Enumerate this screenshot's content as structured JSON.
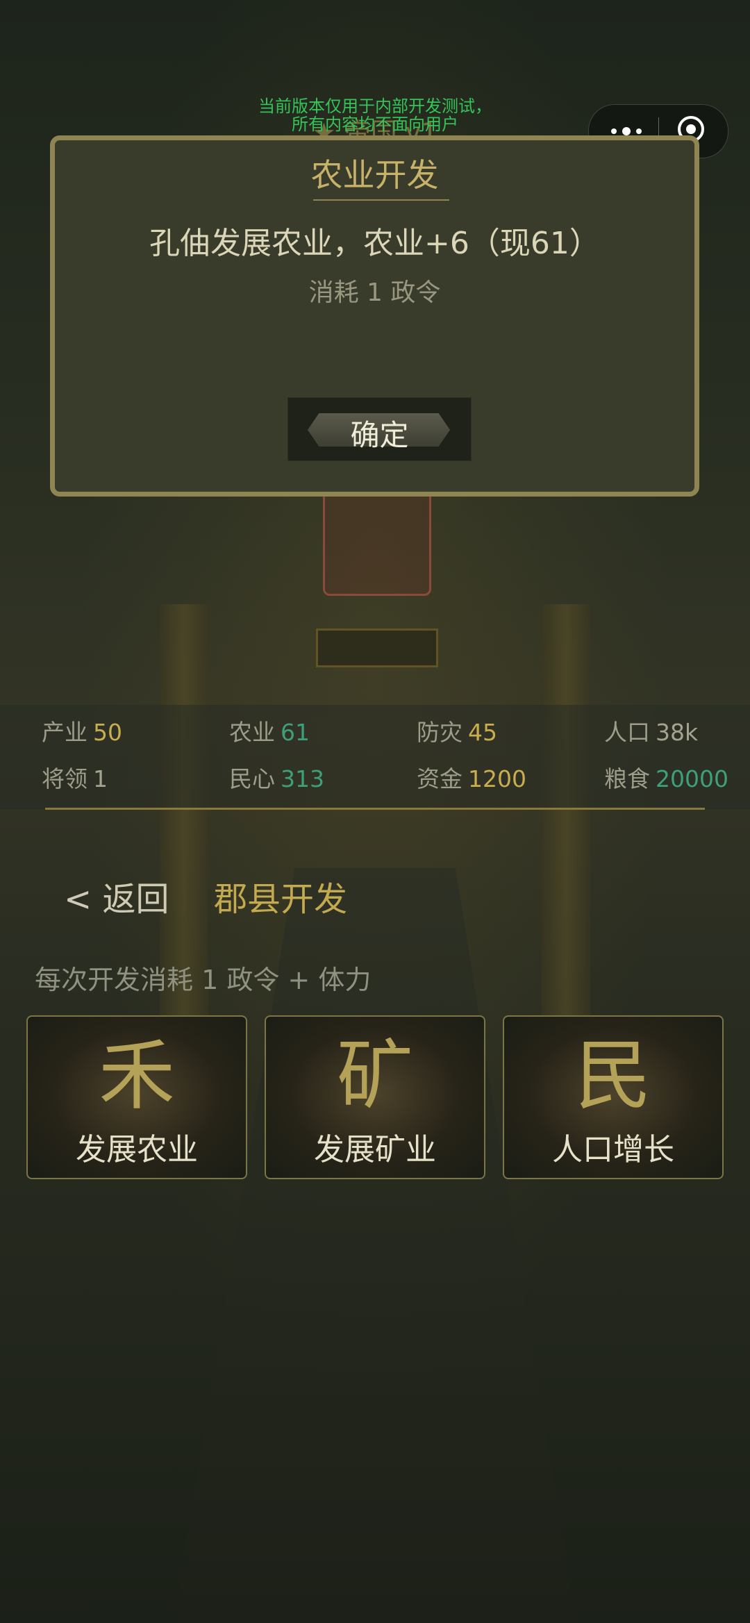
{
  "notice": {
    "line1": "当前版本仅用于内部开发测试，",
    "line2": "所有内容均不面向用户"
  },
  "behind_title": "★ 帝国 v1",
  "modal": {
    "title": "农业开发",
    "message": "孔伷发展农业，农业+6（现61）",
    "cost": "消耗 1 政令",
    "confirm_label": "确定"
  },
  "stats": [
    {
      "label": "产业",
      "value": "50",
      "color": "gold"
    },
    {
      "label": "农业",
      "value": "61",
      "color": "teal"
    },
    {
      "label": "防灾",
      "value": "45",
      "color": "gold"
    },
    {
      "label": "人口",
      "value": "38k",
      "color": "gray"
    },
    {
      "label": "将领",
      "value": "1",
      "color": "gray"
    },
    {
      "label": "民心",
      "value": "313",
      "color": "teal"
    },
    {
      "label": "资金",
      "value": "1200",
      "color": "gold"
    },
    {
      "label": "粮食",
      "value": "20000",
      "color": "teal"
    }
  ],
  "nav": {
    "back_label": "< 返回",
    "section_title": "郡县开发"
  },
  "cost_note": "每次开发消耗 1 政令 + 体力",
  "actions": [
    {
      "glyph": "禾",
      "caption": "发展农业"
    },
    {
      "glyph": "矿",
      "caption": "发展矿业"
    },
    {
      "glyph": "民",
      "caption": "人口增长"
    }
  ],
  "colors": {
    "gold": "#c9ad4e",
    "teal": "#3ea07a",
    "notice_green": "#35c45a",
    "modal_border": "#8e8553"
  }
}
